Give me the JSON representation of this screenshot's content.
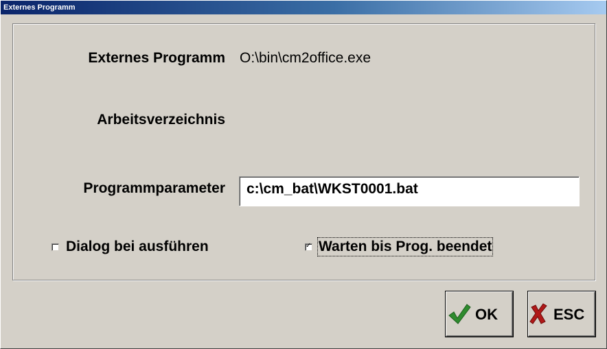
{
  "window": {
    "title": "Externes Programm"
  },
  "form": {
    "program_label": "Externes Programm",
    "program_value": "O:\\bin\\cm2office.exe",
    "workdir_label": "Arbeitsverzeichnis",
    "workdir_value": "",
    "params_label": "Programmparameter",
    "params_value": "c:\\cm_bat\\WKST0001.bat"
  },
  "options": {
    "dialog_label": "Dialog bei ausführen",
    "dialog_checked": false,
    "wait_label": "Warten bis Prog. beendet",
    "wait_checked": true
  },
  "buttons": {
    "ok_label": "OK",
    "esc_label": "ESC"
  },
  "colors": {
    "ok_icon": "#2e8b2e",
    "esc_icon": "#b01818"
  }
}
